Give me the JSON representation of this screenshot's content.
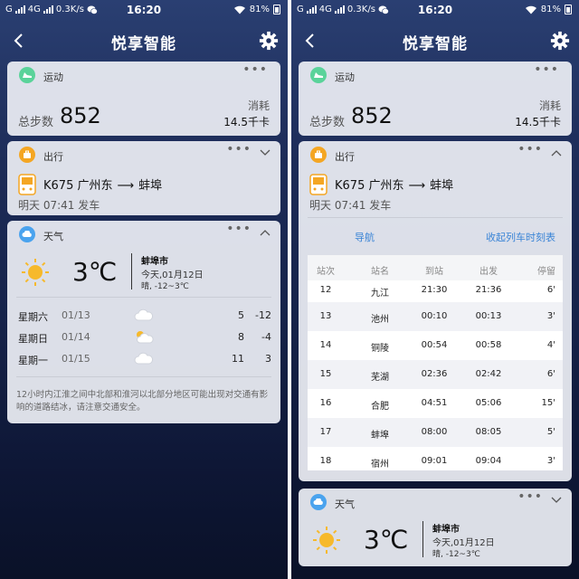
{
  "status": {
    "carrier": "G",
    "network": "4G",
    "speed": "0.3K/s",
    "time": "16:20",
    "battery": "81%"
  },
  "nav": {
    "title": "悦享智能"
  },
  "sport": {
    "label": "运动",
    "steps_label": "总步数",
    "steps": "852",
    "cal_label": "消耗",
    "cal": "14.5千卡"
  },
  "travel": {
    "label": "出行",
    "train": "K675",
    "from": "广州东",
    "arrow": "⟶",
    "to": "蚌埠",
    "depart": "明天 07:41 发车",
    "nav_link": "导航",
    "collapse_link": "收起列车时刻表"
  },
  "weather": {
    "label": "天气",
    "temp": "3℃",
    "city": "蚌埠市",
    "date": "今天,01月12日",
    "desc": "晴, -12~3℃",
    "forecast": [
      {
        "day": "星期六",
        "date": "01/13",
        "icon": "cloud-icon",
        "hi": "5",
        "lo": "-12"
      },
      {
        "day": "星期日",
        "date": "01/14",
        "icon": "partly-cloudy-icon",
        "hi": "8",
        "lo": "-4"
      },
      {
        "day": "星期一",
        "date": "01/15",
        "icon": "cloud-icon",
        "hi": "11",
        "lo": "3"
      }
    ],
    "alert": "12小时内江淮之间中北部和淮河以北部分地区可能出现对交通有影响的道路结冰，请注意交通安全。"
  },
  "schedule": {
    "headers": [
      "站次",
      "站名",
      "到站",
      "出发",
      "停留"
    ],
    "rows": [
      [
        "12",
        "九江",
        "21:30",
        "21:36",
        "6'"
      ],
      [
        "13",
        "池州",
        "00:10",
        "00:13",
        "3'"
      ],
      [
        "14",
        "铜陵",
        "00:54",
        "00:58",
        "4'"
      ],
      [
        "15",
        "芜湖",
        "02:36",
        "02:42",
        "6'"
      ],
      [
        "16",
        "合肥",
        "04:51",
        "05:06",
        "15'"
      ],
      [
        "17",
        "蚌埠",
        "08:00",
        "08:05",
        "5'"
      ],
      [
        "18",
        "宿州",
        "09:01",
        "09:04",
        "3'"
      ]
    ]
  },
  "colors": {
    "sport_icon": "#5ad39a",
    "travel_icon": "#f4a623",
    "weather_icon": "#4aa3ee",
    "link": "#3a84d6",
    "sun": "#f6b92b"
  }
}
